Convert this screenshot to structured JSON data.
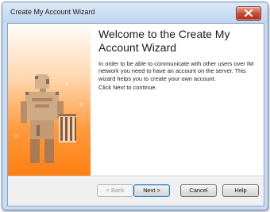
{
  "window": {
    "title": "Create My Account Wizard"
  },
  "wizard": {
    "heading": "Welcome to the Create My Account Wizard",
    "intro": "In order to be able to communicate with other users over IM network you need to have an account on the server. This wizard helps you to create your own account.",
    "continue_hint": "Click Next to continue."
  },
  "buttons": {
    "back": "< Back",
    "next": "Next >",
    "cancel": "Cancel",
    "help": "Help"
  },
  "colors": {
    "panel_gradient_start": "#ffffff",
    "panel_gradient_end": "#ff7f12",
    "figure": "#c8a27e"
  },
  "icons": {
    "close": "close-icon",
    "wizard_graphic": "pixel-person-icon"
  }
}
